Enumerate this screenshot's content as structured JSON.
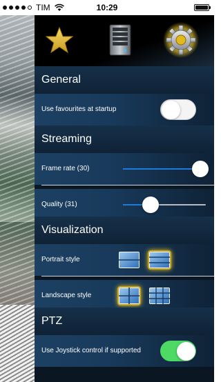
{
  "status_bar": {
    "carrier": "TIM",
    "time": "10:29"
  },
  "toolbar": {
    "favourites_icon": "star-icon",
    "servers_icon": "server-icon",
    "settings_icon": "gear-icon"
  },
  "sections": {
    "general": {
      "title": "General",
      "use_favourites_label": "Use favourites at startup",
      "use_favourites_on": false
    },
    "streaming": {
      "title": "Streaming",
      "frame_rate_label": "Frame rate (30)",
      "frame_rate_fraction": 0.96,
      "quality_label": "Quality (31)",
      "quality_fraction": 0.33
    },
    "visualization": {
      "title": "Visualization",
      "portrait_label": "Portrait style",
      "portrait_selected": "grid-horizontal",
      "landscape_label": "Landscape style",
      "landscape_selected": "grid-2x2"
    },
    "ptz": {
      "title": "PTZ",
      "joystick_label": "Use Joystick control if supported",
      "joystick_on": true
    }
  },
  "colors": {
    "accent_blue": "#1e7bdc",
    "toggle_on": "#4cd964",
    "selection_glow": "#e8c21e"
  }
}
